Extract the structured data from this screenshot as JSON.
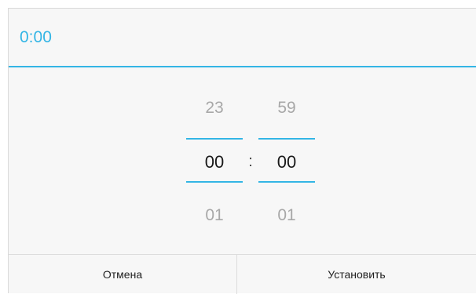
{
  "header": {
    "time": "0:00"
  },
  "picker": {
    "hours": {
      "prev": "23",
      "current": "00",
      "next": "01"
    },
    "separator": ":",
    "minutes": {
      "prev": "59",
      "current": "00",
      "next": "01"
    }
  },
  "footer": {
    "cancel_label": "Отмена",
    "set_label": "Установить"
  },
  "colors": {
    "accent": "#33b5e5",
    "background": "#f7f7f7"
  }
}
